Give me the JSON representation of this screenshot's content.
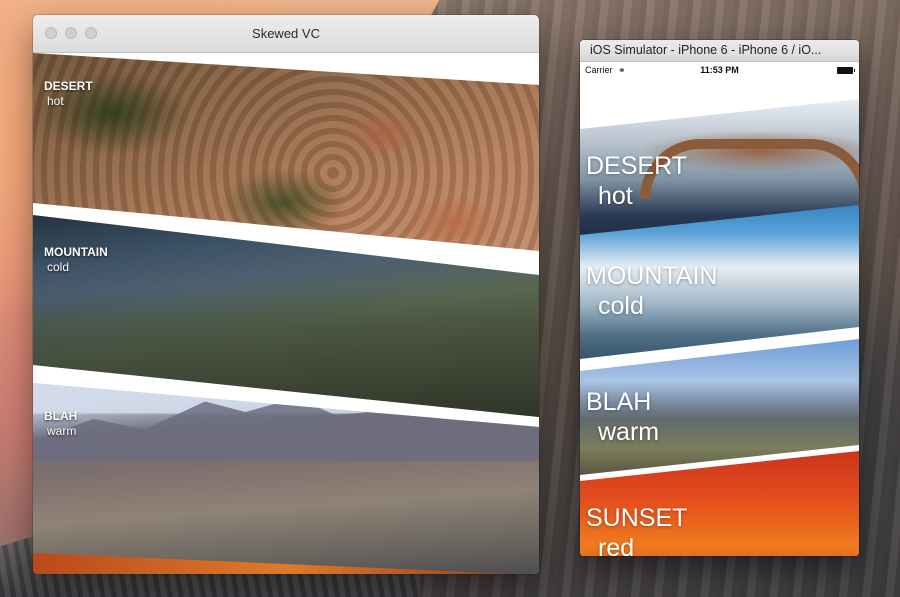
{
  "mac_window": {
    "title": "Skewed VC",
    "bands": [
      {
        "title": "DESERT",
        "subtitle": "hot"
      },
      {
        "title": "MOUNTAIN",
        "subtitle": "cold"
      },
      {
        "title": "BLAH",
        "subtitle": "warm"
      }
    ]
  },
  "simulator": {
    "window_title": "iOS Simulator - iPhone 6 - iPhone 6 / iO...",
    "status_bar": {
      "carrier": "Carrier",
      "time": "11:53 PM"
    },
    "bands": [
      {
        "title": "DESERT",
        "subtitle": "hot"
      },
      {
        "title": "MOUNTAIN",
        "subtitle": "cold"
      },
      {
        "title": "BLAH",
        "subtitle": "warm"
      },
      {
        "title": "SUNSET",
        "subtitle": "red"
      }
    ]
  },
  "icons": {
    "wifi": "wifi-icon",
    "battery": "battery-icon"
  }
}
